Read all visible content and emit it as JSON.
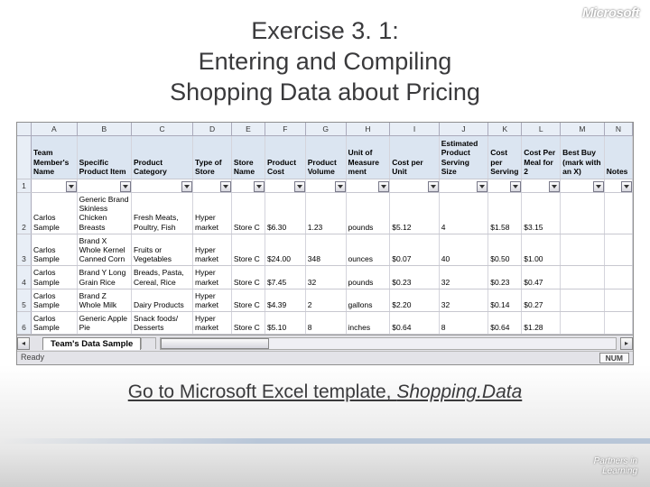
{
  "logo": "Microsoft",
  "title_line1": "Exercise 3. 1:",
  "title_line2": "Entering and Compiling",
  "title_line3": "Shopping Data about Pricing",
  "columns": [
    "A",
    "B",
    "C",
    "D",
    "E",
    "F",
    "G",
    "H",
    "I",
    "J",
    "K",
    "L",
    "M",
    "N"
  ],
  "headers": [
    "Team Member's Name",
    "Specific Product Item",
    "Product Category",
    "Type of Store",
    "Store Name",
    "Product Cost",
    "Product Volume",
    "Unit of Measure ment",
    "Cost per Unit",
    "Estimated Product Serving Size",
    "Cost per Serving",
    "Cost Per Meal for 2",
    "Best Buy (mark with an X)",
    "Notes"
  ],
  "rows": [
    {
      "n": "2",
      "cells": [
        "Carlos Sample",
        "Generic Brand Skinless Chicken Breasts",
        "Fresh Meats, Poultry, Fish",
        "Hyper market",
        "Store C",
        "$6.30",
        "1.23",
        "pounds",
        "$5.12",
        "4",
        "$1.58",
        "$3.15",
        "",
        ""
      ]
    },
    {
      "n": "3",
      "cells": [
        "Carlos Sample",
        "Brand X Whole Kernel Canned Corn",
        "Fruits or Vegetables",
        "Hyper market",
        "Store C",
        "$24.00",
        "348",
        "ounces",
        "$0.07",
        "40",
        "$0.50",
        "$1.00",
        "",
        ""
      ]
    },
    {
      "n": "4",
      "cells": [
        "Carlos Sample",
        "Brand Y Long Grain Rice",
        "Breads, Pasta, Cereal, Rice",
        "Hyper market",
        "Store C",
        "$7.45",
        "32",
        "pounds",
        "$0.23",
        "32",
        "$0.23",
        "$0.47",
        "",
        ""
      ]
    },
    {
      "n": "5",
      "cells": [
        "Carlos Sample",
        "Brand Z Whole Milk",
        "Dairy Products",
        "Hyper market",
        "Store C",
        "$4.39",
        "2",
        "gallons",
        "$2.20",
        "32",
        "$0.14",
        "$0.27",
        "",
        ""
      ]
    },
    {
      "n": "6",
      "cells": [
        "Carlos Sample",
        "Generic Apple Pie",
        "Snack foods/ Desserts",
        "Hyper market",
        "Store C",
        "$5.10",
        "8",
        "inches",
        "$0.64",
        "8",
        "$0.64",
        "$1.28",
        "",
        ""
      ]
    }
  ],
  "sheet_tab": "Team's Data Sample",
  "status_left": "Ready",
  "status_right": "NUM",
  "footer_text": "Go to Microsoft Excel template, ",
  "footer_italic": "Shopping.Data",
  "partners1": "Partners in",
  "partners2": "Learning"
}
